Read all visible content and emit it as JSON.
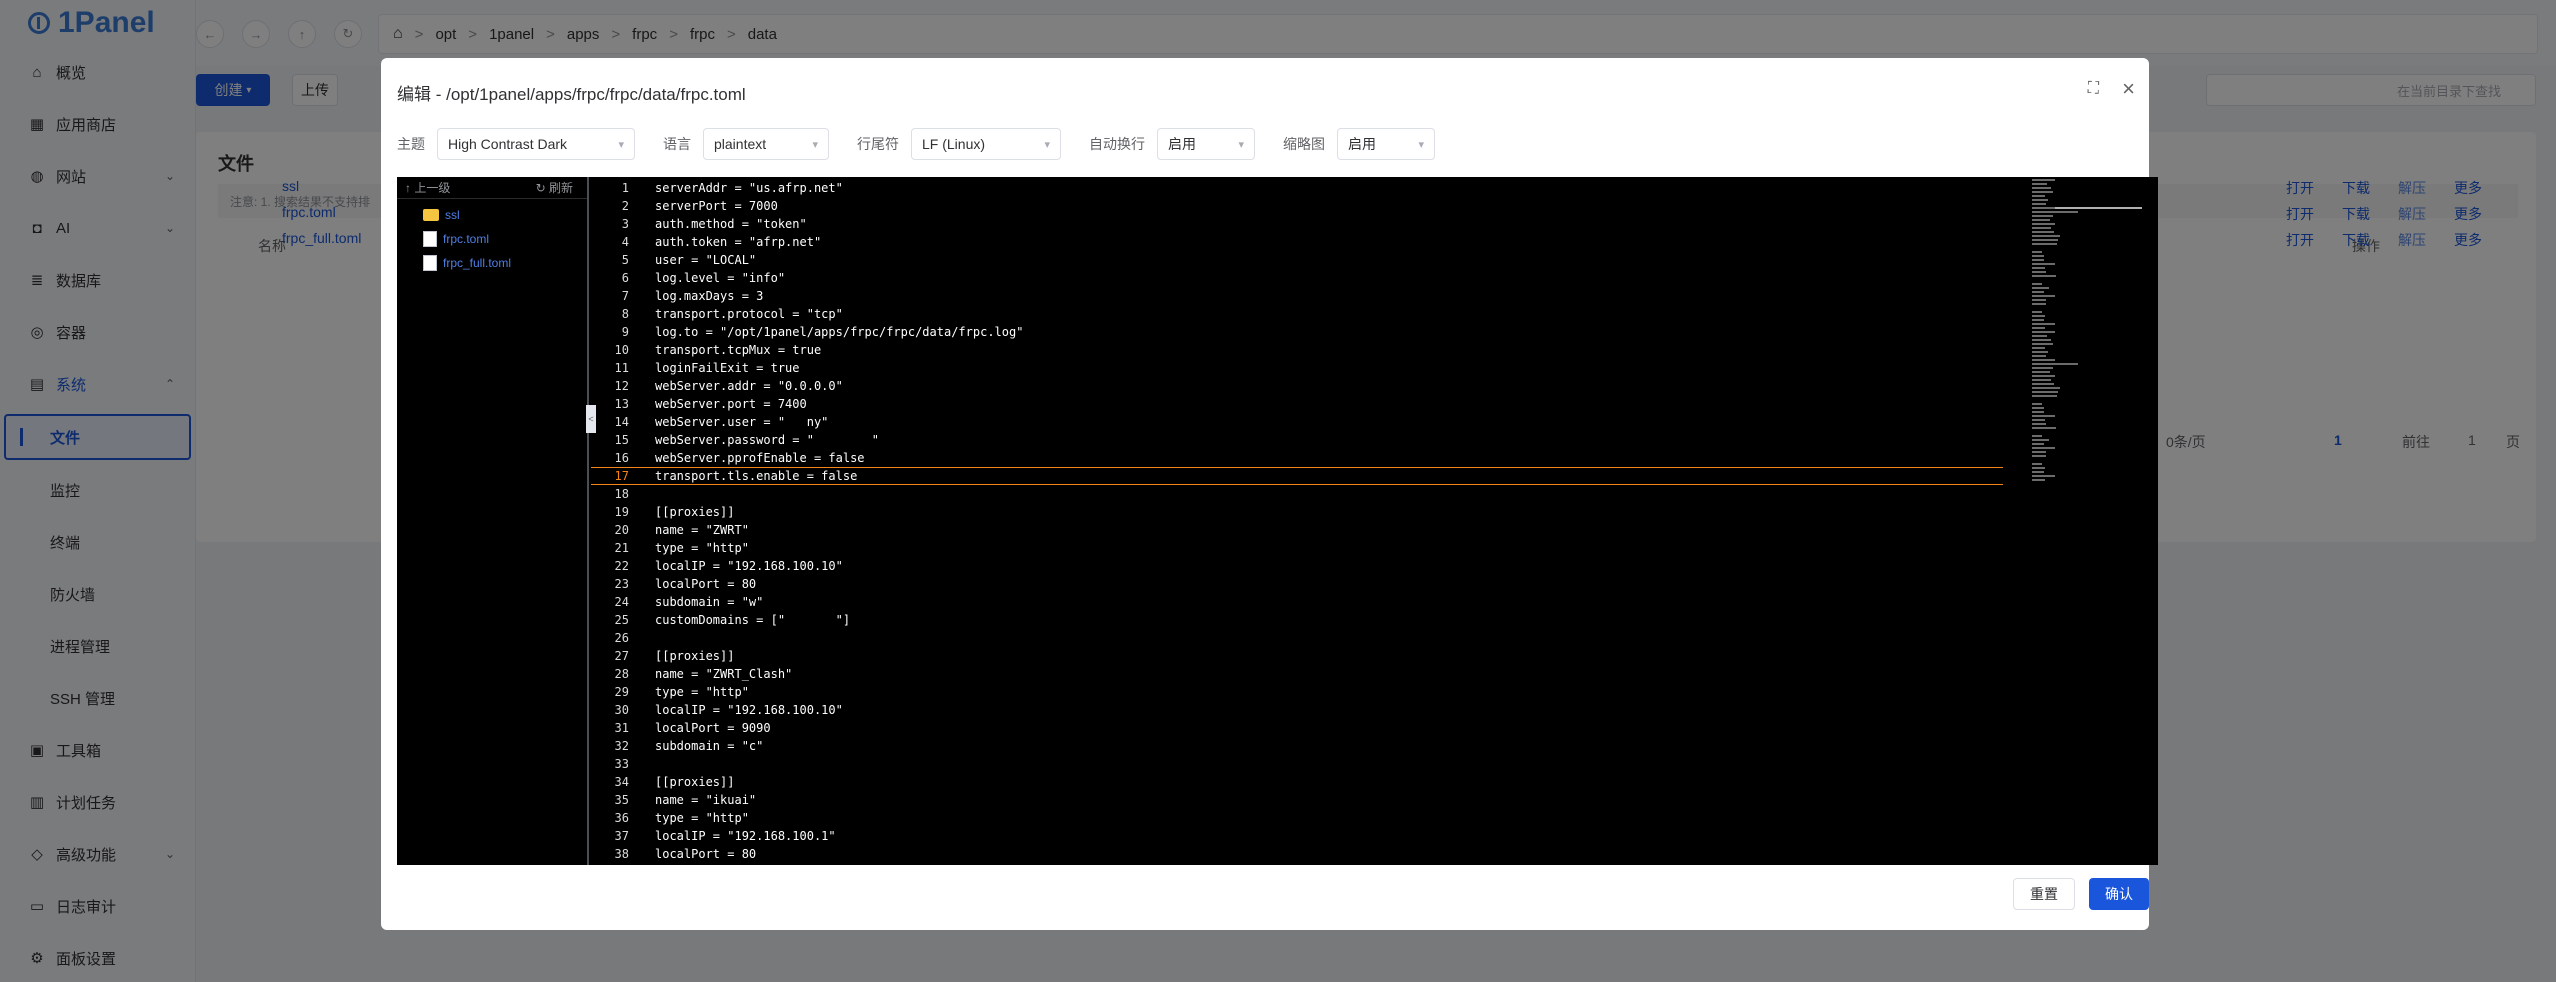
{
  "app": {
    "logo_text": "1Panel"
  },
  "sidebar": {
    "items": [
      {
        "label": "概览",
        "icon": "home-icon"
      },
      {
        "label": "应用商店",
        "icon": "grid-icon"
      },
      {
        "label": "网站",
        "icon": "globe-icon",
        "chevron": "down"
      },
      {
        "label": "AI",
        "icon": "robot-icon",
        "chevron": "down"
      },
      {
        "label": "数据库",
        "icon": "database-icon"
      },
      {
        "label": "容器",
        "icon": "container-icon"
      },
      {
        "label": "系统",
        "icon": "system-icon",
        "chevron": "up"
      },
      {
        "label": "文件",
        "sub": true,
        "active": true
      },
      {
        "label": "监控",
        "sub": true
      },
      {
        "label": "终端",
        "sub": true
      },
      {
        "label": "防火墙",
        "sub": true
      },
      {
        "label": "进程管理",
        "sub": true
      },
      {
        "label": "SSH 管理",
        "sub": true
      },
      {
        "label": "工具箱",
        "icon": "toolbox-icon"
      },
      {
        "label": "计划任务",
        "icon": "calendar-icon"
      },
      {
        "label": "高级功能",
        "icon": "diamond-icon",
        "chevron": "down"
      },
      {
        "label": "日志审计",
        "icon": "log-icon"
      },
      {
        "label": "面板设置",
        "icon": "settings-icon"
      }
    ]
  },
  "breadcrumb": [
    "opt",
    "1panel",
    "apps",
    "frpc",
    "frpc",
    "data"
  ],
  "page": {
    "create_label": "创建",
    "upload_label": "上传",
    "search_placeholder": "在当前目录下查找",
    "title": "文件",
    "note": "注意: 1. 搜索结果不支持排",
    "col_name": "名称",
    "col_actions": "操作",
    "rows": [
      {
        "name": "ssl",
        "type": "folder",
        "num": "3"
      },
      {
        "name": "frpc.toml",
        "type": "file",
        "num": "3"
      },
      {
        "name": "frpc_full.toml",
        "type": "file",
        "num": "1"
      }
    ],
    "actions": [
      "打开",
      "下载",
      "解压",
      "更多"
    ],
    "pager": {
      "size": "0条/页",
      "page": "1",
      "goto_label": "前往",
      "goto_value": "1",
      "page_suffix": "页"
    }
  },
  "modal": {
    "title": "编辑 - /opt/1panel/apps/frpc/frpc/data/frpc.toml",
    "options": [
      {
        "label": "主题",
        "value": "High Contrast Dark"
      },
      {
        "label": "语言",
        "value": "plaintext"
      },
      {
        "label": "行尾符",
        "value": "LF (Linux)"
      },
      {
        "label": "自动换行",
        "value": "启用"
      },
      {
        "label": "缩略图",
        "value": "启用"
      }
    ],
    "tree": {
      "up_label": "上一级",
      "refresh_label": "刷新",
      "items": [
        {
          "name": "ssl",
          "type": "folder"
        },
        {
          "name": "frpc.toml",
          "type": "file"
        },
        {
          "name": "frpc_full.toml",
          "type": "file"
        }
      ]
    },
    "current_line": 17,
    "code_lines": [
      "serverAddr = \"us.afrp.net\"",
      "serverPort = 7000",
      "auth.method = \"token\"",
      "auth.token = \"afrp.net\"",
      "user = \"LOCAL\"",
      "log.level = \"info\"",
      "log.maxDays = 3",
      "transport.protocol = \"tcp\"",
      "log.to = \"/opt/1panel/apps/frpc/frpc/data/frpc.log\"",
      "transport.tcpMux = true",
      "loginFailExit = true",
      "webServer.addr = \"0.0.0.0\"",
      "webServer.port = 7400",
      "webServer.user = \"   ny\"",
      "webServer.password = \"        \"",
      "webServer.pprofEnable = false",
      "transport.tls.enable = false",
      "",
      "[[proxies]]",
      "name = \"ZWRT\"",
      "type = \"http\"",
      "localIP = \"192.168.100.10\"",
      "localPort = 80",
      "subdomain = \"w\"",
      "customDomains = [\"       \"]",
      "",
      "[[proxies]]",
      "name = \"ZWRT_Clash\"",
      "type = \"http\"",
      "localIP = \"192.168.100.10\"",
      "localPort = 9090",
      "subdomain = \"c\"",
      "",
      "[[proxies]]",
      "name = \"ikuai\"",
      "type = \"http\"",
      "localIP = \"192.168.100.1\"",
      "localPort = 80"
    ],
    "reset_label": "重置",
    "confirm_label": "确认"
  }
}
